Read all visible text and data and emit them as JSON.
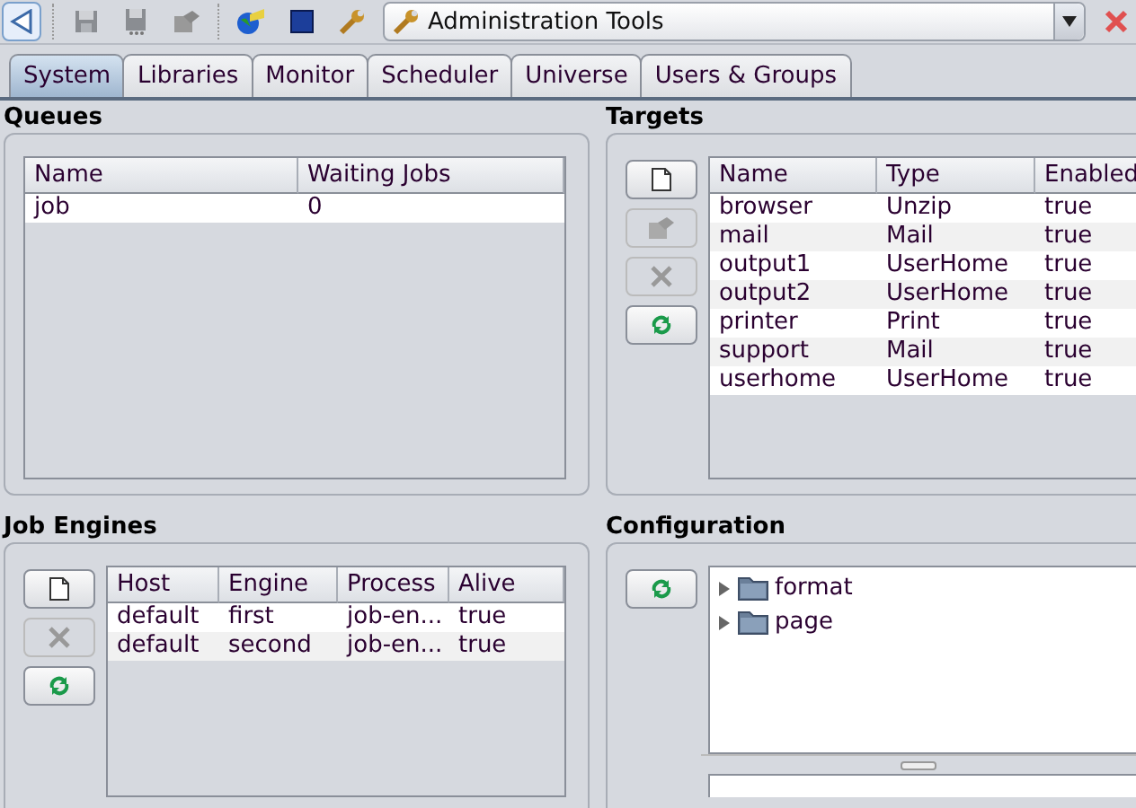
{
  "toolbar": {
    "combo": {
      "value": "Administration Tools"
    }
  },
  "tabs": [
    {
      "label": "System",
      "selected": true
    },
    {
      "label": "Libraries",
      "selected": false
    },
    {
      "label": "Monitor",
      "selected": false
    },
    {
      "label": "Scheduler",
      "selected": false
    },
    {
      "label": "Universe",
      "selected": false
    },
    {
      "label": "Users & Groups",
      "selected": false
    }
  ],
  "queues": {
    "title": "Queues",
    "columns": [
      "Name",
      "Waiting Jobs"
    ],
    "rows": [
      {
        "cells": [
          "job",
          "0"
        ],
        "selected": false
      }
    ]
  },
  "targets": {
    "title": "Targets",
    "buttons": [
      {
        "kind": "new",
        "disabled": false
      },
      {
        "kind": "edit",
        "disabled": true
      },
      {
        "kind": "delete",
        "disabled": true
      },
      {
        "kind": "refresh",
        "disabled": false
      }
    ],
    "columns": [
      "Name",
      "Type",
      "Enabled"
    ],
    "rows": [
      {
        "cells": [
          "browser",
          "Unzip",
          "true"
        ]
      },
      {
        "cells": [
          "mail",
          "Mail",
          "true"
        ]
      },
      {
        "cells": [
          "output1",
          "UserHome",
          "true"
        ]
      },
      {
        "cells": [
          "output2",
          "UserHome",
          "true"
        ]
      },
      {
        "cells": [
          "printer",
          "Print",
          "true"
        ]
      },
      {
        "cells": [
          "support",
          "Mail",
          "true"
        ]
      },
      {
        "cells": [
          "userhome",
          "UserHome",
          "true"
        ]
      }
    ]
  },
  "job_engines": {
    "title": "Job Engines",
    "buttons": [
      {
        "kind": "new",
        "disabled": false
      },
      {
        "kind": "delete",
        "disabled": true
      },
      {
        "kind": "refresh",
        "disabled": false
      }
    ],
    "columns": [
      "Host",
      "Engine",
      "Process",
      "Alive"
    ],
    "rows": [
      {
        "cells": [
          "default",
          "first",
          "job-en...",
          "true"
        ]
      },
      {
        "cells": [
          "default",
          "second",
          "job-en...",
          "true"
        ]
      }
    ]
  },
  "configuration": {
    "title": "Configuration",
    "buttons": [
      {
        "kind": "refresh",
        "disabled": false
      }
    ],
    "tree": [
      {
        "label": "format",
        "expanded": false
      },
      {
        "label": "page",
        "expanded": false
      }
    ]
  }
}
